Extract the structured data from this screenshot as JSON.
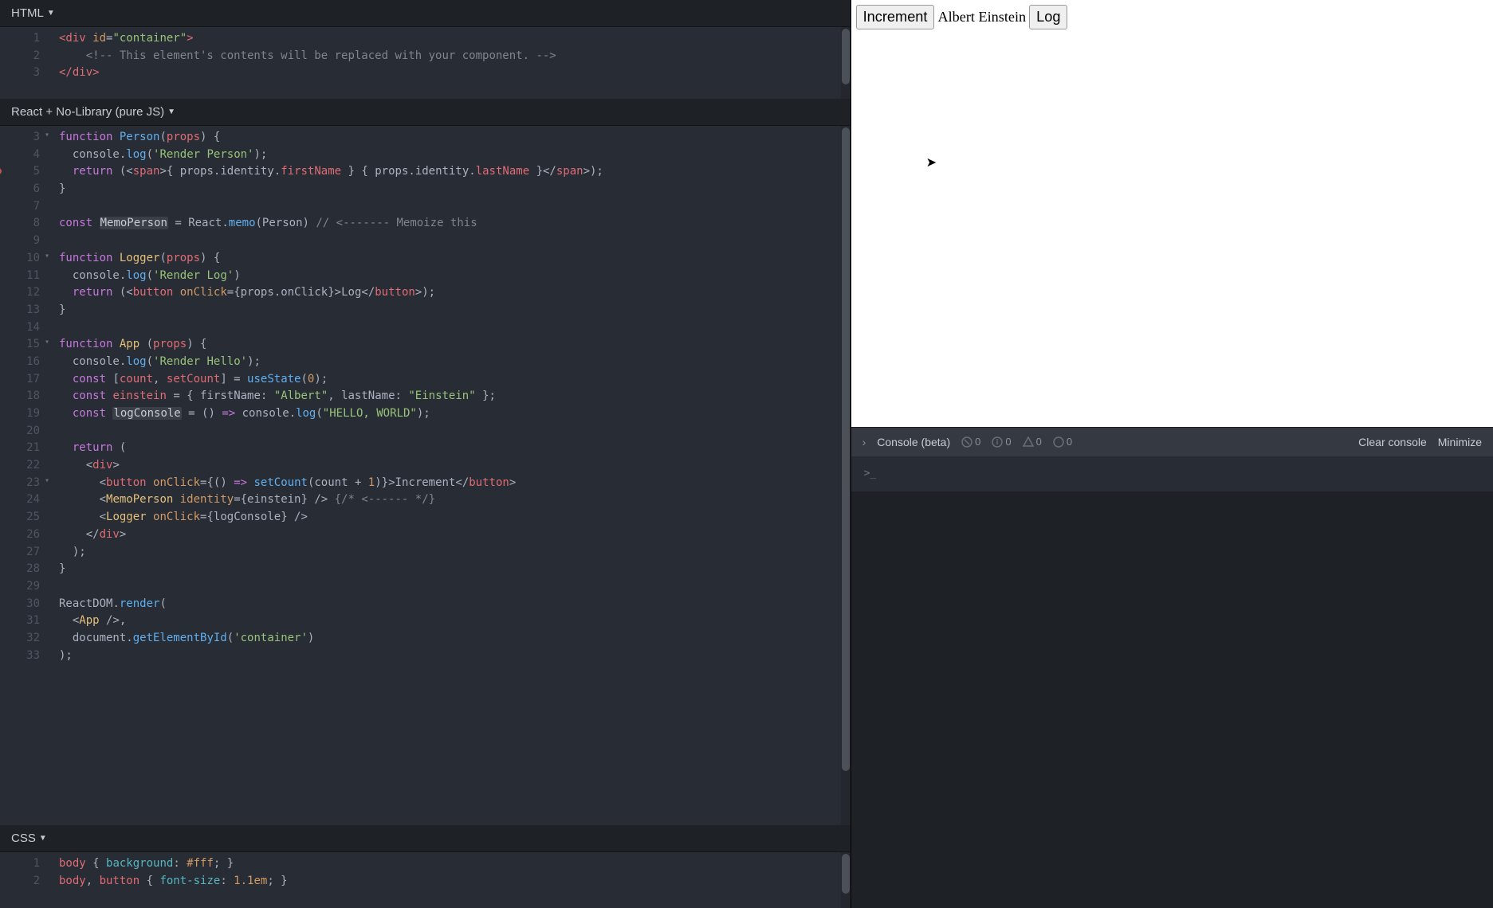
{
  "panels": {
    "html": "HTML",
    "js": "React + No-Library (pure JS)",
    "css": "CSS"
  },
  "html_lines": [
    {
      "n": 1,
      "tokens": [
        [
          "tag",
          "<div"
        ],
        [
          "white",
          " "
        ],
        [
          "attr",
          "id"
        ],
        [
          "punct",
          "="
        ],
        [
          "str",
          "\"container\""
        ],
        [
          "tag",
          ">"
        ]
      ]
    },
    {
      "n": 2,
      "tokens": [
        [
          "white",
          "    "
        ],
        [
          "comm",
          "<!-- This element's contents will be replaced with your component. -->"
        ]
      ]
    },
    {
      "n": 3,
      "tokens": [
        [
          "tag",
          "</div>"
        ]
      ]
    }
  ],
  "js_lines": [
    {
      "n": 3,
      "fold": true,
      "tokens": [
        [
          "kw",
          "function"
        ],
        [
          "white",
          " "
        ],
        [
          "fn",
          "Person"
        ],
        [
          "punct",
          "("
        ],
        [
          "id",
          "props"
        ],
        [
          "punct",
          ") {"
        ]
      ]
    },
    {
      "n": 4,
      "tokens": [
        [
          "white",
          "  "
        ],
        [
          "white",
          "console"
        ],
        [
          "punct",
          "."
        ],
        [
          "fn",
          "log"
        ],
        [
          "punct",
          "("
        ],
        [
          "str",
          "'Render Person'"
        ],
        [
          "punct",
          ");"
        ]
      ]
    },
    {
      "n": 5,
      "bp": true,
      "tokens": [
        [
          "white",
          "  "
        ],
        [
          "kw",
          "return"
        ],
        [
          "white",
          " "
        ],
        [
          "punct",
          "(<"
        ],
        [
          "tag",
          "span"
        ],
        [
          "punct",
          ">{ "
        ],
        [
          "white",
          "props"
        ],
        [
          "punct",
          "."
        ],
        [
          "white",
          "identity"
        ],
        [
          "punct",
          "."
        ],
        [
          "id",
          "firstName"
        ],
        [
          "white",
          " } { "
        ],
        [
          "white",
          "props"
        ],
        [
          "punct",
          "."
        ],
        [
          "white",
          "identity"
        ],
        [
          "punct",
          "."
        ],
        [
          "id",
          "lastName"
        ],
        [
          "white",
          " }"
        ],
        [
          "punct",
          "</"
        ],
        [
          "tag",
          "span"
        ],
        [
          "punct",
          ">);"
        ]
      ]
    },
    {
      "n": 6,
      "tokens": [
        [
          "punct",
          "}"
        ]
      ]
    },
    {
      "n": 7,
      "tokens": []
    },
    {
      "n": 8,
      "tokens": [
        [
          "kw",
          "const"
        ],
        [
          "white",
          " "
        ],
        [
          "varh",
          "MemoPerson"
        ],
        [
          "white",
          " = "
        ],
        [
          "white",
          "React"
        ],
        [
          "punct",
          "."
        ],
        [
          "fn",
          "memo"
        ],
        [
          "punct",
          "(Person) "
        ],
        [
          "comm",
          "// <------- Memoize this"
        ]
      ]
    },
    {
      "n": 9,
      "tokens": []
    },
    {
      "n": 10,
      "fold": true,
      "tokens": [
        [
          "kw",
          "function"
        ],
        [
          "white",
          " "
        ],
        [
          "fnc",
          "Logger"
        ],
        [
          "punct",
          "("
        ],
        [
          "id",
          "props"
        ],
        [
          "punct",
          ") {"
        ]
      ]
    },
    {
      "n": 11,
      "tokens": [
        [
          "white",
          "  "
        ],
        [
          "white",
          "console"
        ],
        [
          "punct",
          "."
        ],
        [
          "fn",
          "log"
        ],
        [
          "punct",
          "("
        ],
        [
          "str",
          "'Render Log'"
        ],
        [
          "punct",
          ")"
        ]
      ]
    },
    {
      "n": 12,
      "tokens": [
        [
          "white",
          "  "
        ],
        [
          "kw",
          "return"
        ],
        [
          "white",
          " "
        ],
        [
          "punct",
          "(<"
        ],
        [
          "tag",
          "button"
        ],
        [
          "white",
          " "
        ],
        [
          "attr",
          "onClick"
        ],
        [
          "punct",
          "={"
        ],
        [
          "white",
          "props"
        ],
        [
          "punct",
          "."
        ],
        [
          "white",
          "onClick"
        ],
        [
          "punct",
          "}>"
        ],
        [
          "white",
          "Log"
        ],
        [
          "punct",
          "</"
        ],
        [
          "tag",
          "button"
        ],
        [
          "punct",
          ">);"
        ]
      ]
    },
    {
      "n": 13,
      "tokens": [
        [
          "punct",
          "}"
        ]
      ]
    },
    {
      "n": 14,
      "tokens": []
    },
    {
      "n": 15,
      "fold": true,
      "tokens": [
        [
          "kw",
          "function"
        ],
        [
          "white",
          " "
        ],
        [
          "fnc",
          "App"
        ],
        [
          "white",
          " "
        ],
        [
          "punct",
          "("
        ],
        [
          "id",
          "props"
        ],
        [
          "punct",
          ") {"
        ]
      ]
    },
    {
      "n": 16,
      "tokens": [
        [
          "white",
          "  "
        ],
        [
          "white",
          "console"
        ],
        [
          "punct",
          "."
        ],
        [
          "fn",
          "log"
        ],
        [
          "punct",
          "("
        ],
        [
          "str",
          "'Render Hello'"
        ],
        [
          "punct",
          ");"
        ]
      ]
    },
    {
      "n": 17,
      "tokens": [
        [
          "white",
          "  "
        ],
        [
          "kw",
          "const"
        ],
        [
          "white",
          " ["
        ],
        [
          "id",
          "count"
        ],
        [
          "punct",
          ", "
        ],
        [
          "id",
          "setCount"
        ],
        [
          "punct",
          "] = "
        ],
        [
          "fn",
          "useState"
        ],
        [
          "punct",
          "("
        ],
        [
          "num",
          "0"
        ],
        [
          "punct",
          ");"
        ]
      ]
    },
    {
      "n": 18,
      "tokens": [
        [
          "white",
          "  "
        ],
        [
          "kw",
          "const"
        ],
        [
          "white",
          " "
        ],
        [
          "id",
          "einstein"
        ],
        [
          "white",
          " = { "
        ],
        [
          "white",
          "firstName"
        ],
        [
          "punct",
          ": "
        ],
        [
          "str",
          "\"Albert\""
        ],
        [
          "punct",
          ", "
        ],
        [
          "white",
          "lastName"
        ],
        [
          "punct",
          ": "
        ],
        [
          "str",
          "\"Einstein\""
        ],
        [
          "punct",
          " };"
        ]
      ]
    },
    {
      "n": 19,
      "tokens": [
        [
          "white",
          "  "
        ],
        [
          "kw",
          "const"
        ],
        [
          "white",
          " "
        ],
        [
          "varh",
          "logConsole"
        ],
        [
          "white",
          " = () "
        ],
        [
          "kw",
          "=>"
        ],
        [
          "white",
          " console"
        ],
        [
          "punct",
          "."
        ],
        [
          "fn",
          "log"
        ],
        [
          "punct",
          "("
        ],
        [
          "str",
          "\"HELLO, WORLD\""
        ],
        [
          "punct",
          ");"
        ]
      ]
    },
    {
      "n": 20,
      "tokens": []
    },
    {
      "n": 21,
      "tokens": [
        [
          "white",
          "  "
        ],
        [
          "kw",
          "return"
        ],
        [
          "white",
          " ("
        ]
      ]
    },
    {
      "n": 22,
      "tokens": [
        [
          "white",
          "    "
        ],
        [
          "punct",
          "<"
        ],
        [
          "tag",
          "div"
        ],
        [
          "punct",
          ">"
        ]
      ]
    },
    {
      "n": 23,
      "fold": true,
      "tokens": [
        [
          "white",
          "      "
        ],
        [
          "punct",
          "<"
        ],
        [
          "tag",
          "button"
        ],
        [
          "white",
          " "
        ],
        [
          "attr",
          "onClick"
        ],
        [
          "punct",
          "={() "
        ],
        [
          "kw",
          "=>"
        ],
        [
          "white",
          " "
        ],
        [
          "fn",
          "setCount"
        ],
        [
          "punct",
          "(count + "
        ],
        [
          "num",
          "1"
        ],
        [
          "punct",
          ")}>"
        ],
        [
          "white",
          "Increment"
        ],
        [
          "punct",
          "</"
        ],
        [
          "tag",
          "button"
        ],
        [
          "punct",
          ">"
        ]
      ]
    },
    {
      "n": 24,
      "tokens": [
        [
          "white",
          "      "
        ],
        [
          "punct",
          "<"
        ],
        [
          "jsxtag",
          "MemoPerson"
        ],
        [
          "white",
          " "
        ],
        [
          "attr",
          "identity"
        ],
        [
          "punct",
          "={einstein} /> "
        ],
        [
          "comm",
          "{/* <------ */}"
        ]
      ]
    },
    {
      "n": 25,
      "tokens": [
        [
          "white",
          "      "
        ],
        [
          "punct",
          "<"
        ],
        [
          "jsxtag",
          "Logger"
        ],
        [
          "white",
          " "
        ],
        [
          "attr",
          "onClick"
        ],
        [
          "punct",
          "={logConsole} />"
        ]
      ]
    },
    {
      "n": 26,
      "tokens": [
        [
          "white",
          "    "
        ],
        [
          "punct",
          "</"
        ],
        [
          "tag",
          "div"
        ],
        [
          "punct",
          ">"
        ]
      ]
    },
    {
      "n": 27,
      "tokens": [
        [
          "white",
          "  );"
        ]
      ]
    },
    {
      "n": 28,
      "tokens": [
        [
          "punct",
          "}"
        ]
      ]
    },
    {
      "n": 29,
      "tokens": []
    },
    {
      "n": 30,
      "tokens": [
        [
          "white",
          "ReactDOM"
        ],
        [
          "punct",
          "."
        ],
        [
          "fn",
          "render"
        ],
        [
          "punct",
          "("
        ]
      ]
    },
    {
      "n": 31,
      "tokens": [
        [
          "white",
          "  "
        ],
        [
          "punct",
          "<"
        ],
        [
          "jsxtag",
          "App"
        ],
        [
          "white",
          " "
        ],
        [
          "punct",
          "/>,"
        ]
      ]
    },
    {
      "n": 32,
      "tokens": [
        [
          "white",
          "  document"
        ],
        [
          "punct",
          "."
        ],
        [
          "fn",
          "getElementById"
        ],
        [
          "punct",
          "("
        ],
        [
          "str",
          "'container'"
        ],
        [
          "punct",
          ")"
        ]
      ]
    },
    {
      "n": 33,
      "tokens": [
        [
          "punct",
          ");"
        ]
      ]
    }
  ],
  "css_lines": [
    {
      "n": 1,
      "tokens": [
        [
          "tag",
          "body"
        ],
        [
          "white",
          " { "
        ],
        [
          "prop",
          "background"
        ],
        [
          "punct",
          ": "
        ],
        [
          "num",
          "#fff"
        ],
        [
          "punct",
          "; }"
        ]
      ]
    },
    {
      "n": 2,
      "tokens": [
        [
          "tag",
          "body"
        ],
        [
          "punct",
          ", "
        ],
        [
          "tag",
          "button"
        ],
        [
          "white",
          " { "
        ],
        [
          "prop",
          "font-size"
        ],
        [
          "punct",
          ": "
        ],
        [
          "num",
          "1.1em"
        ],
        [
          "punct",
          "; }"
        ]
      ]
    }
  ],
  "output": {
    "btn_increment": "Increment",
    "person_text": "Albert Einstein",
    "btn_log": "Log"
  },
  "console": {
    "title": "Console (beta)",
    "errors": "0",
    "info": "0",
    "warn": "0",
    "generic": "0",
    "clear": "Clear console",
    "minimize": "Minimize",
    "prompt": ">_"
  }
}
